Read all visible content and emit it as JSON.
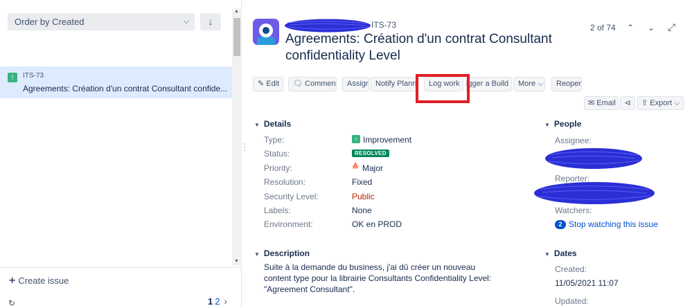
{
  "left_panel": {
    "order_select": "Order by Created",
    "issue": {
      "key": "ITS-73",
      "summary": "Agreements: Création d'un contrat Consultant confide..."
    },
    "create_issue": "Create issue",
    "pager": {
      "current": "1",
      "next_page": "2"
    }
  },
  "header": {
    "key": "ITS-73",
    "title": "Agreements: Création d'un contrat Consultant confidentiality Level",
    "position": "2 of 74"
  },
  "toolbar": {
    "edit": "Edit",
    "comment": "Comment",
    "assign": "Assign",
    "notify": "Notify Planning",
    "log_work": "Log work",
    "trigger_build": "Trigger a Build",
    "more": "More",
    "reopen": "Reopen",
    "email": "Email",
    "export": "Export"
  },
  "details": {
    "title": "Details",
    "type_label": "Type:",
    "type_value": "Improvement",
    "status_label": "Status:",
    "status_value": "RESOLVED",
    "priority_label": "Priority:",
    "priority_value": "Major",
    "resolution_label": "Resolution:",
    "resolution_value": "Fixed",
    "security_label": "Security Level:",
    "security_value": "Public",
    "labels_label": "Labels:",
    "labels_value": "None",
    "environment_label": "Environment:",
    "environment_value": "OK en PROD"
  },
  "people": {
    "title": "People",
    "assignee_label": "Assignee:",
    "reporter_label": "Reporter:",
    "watchers_label": "Watchers:",
    "watch_count": "2",
    "watch_link": "Stop watching this issue"
  },
  "description": {
    "title": "Description",
    "text": "Suite à la demande du business, j'ai dû créer un nouveau content type pour la librairie Consultants Confidentiality Level: \"Agreement Consultant\"."
  },
  "dates": {
    "title": "Dates",
    "created_label": "Created:",
    "created_value": "11/05/2021 11:07",
    "updated_label": "Updated:"
  },
  "colors": {
    "highlight": "#e31e24",
    "redaction": "#2b2fd6",
    "selected_row": "#deebff",
    "resolved": "#00875a",
    "link": "#0052cc"
  }
}
